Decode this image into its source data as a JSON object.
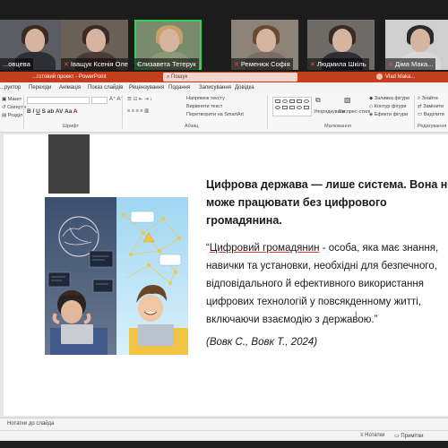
{
  "meeting": {
    "participants": [
      {
        "name": "...овцева",
        "muted": false
      },
      {
        "name": "Іващук Ксенія Олекса...",
        "muted": true
      },
      {
        "name": "Єлизавета Тетерук",
        "muted": false,
        "active": true
      },
      {
        "name": "Ременюк Софія",
        "muted": true
      },
      {
        "name": "Людмила Шкіль",
        "muted": true
      },
      {
        "name": "Діма Мака...",
        "muted": true
      }
    ]
  },
  "app": {
    "title": "...готовий проект - PowerPoint",
    "search_placeholder": "Пошук",
    "user": "Vlad Maka..."
  },
  "tabs": [
    "...руктор",
    "Перехіди",
    "Анімація",
    "Показ слайдів",
    "Рецензування",
    "Подання",
    "Записування",
    "Довідка"
  ],
  "ribbon": {
    "clipboard_items": [
      "Макет",
      "Скинути",
      "Розділ"
    ],
    "font_group": "Шрифт",
    "paragraph_group": "Абзац",
    "paragraph_items": [
      "Напрямок тексту",
      "Вирівняти текст",
      "Перетворити на SmartArt"
    ],
    "drawing_group": "Малювання",
    "arrange_label": "Упорядкувати",
    "quick_styles_label": "Експрес-стилі",
    "shape_items": [
      "Заливка фігури",
      "Контур фігури",
      "Ефекти фігури"
    ],
    "editing_group": "Редагування",
    "editing_items": [
      "Знайти",
      "Замінити",
      "Виділити"
    ]
  },
  "slide": {
    "heading": "Цифрова держава — лише система. Вона не може працювати без цифрового громадянина.",
    "quote_term": "Цифровий громадянин",
    "quote_rest": " - особа, яка має знання, навички та установки, необхідні для безпечного, відповідального й ефективного використання цифрових технологій у повсякденному житті, включаючи взаємодію з державою.”",
    "quote_open": "“",
    "citation": "(Вовк С., Вовк Т., 2024)"
  },
  "notes": {
    "label": "Нотатки до слайда"
  },
  "status": {
    "notes_btn": "Нотатки",
    "display_btn": "Примітки"
  },
  "colors": {
    "accent": "#c43e1c",
    "active_speaker": "#2fd35b"
  }
}
